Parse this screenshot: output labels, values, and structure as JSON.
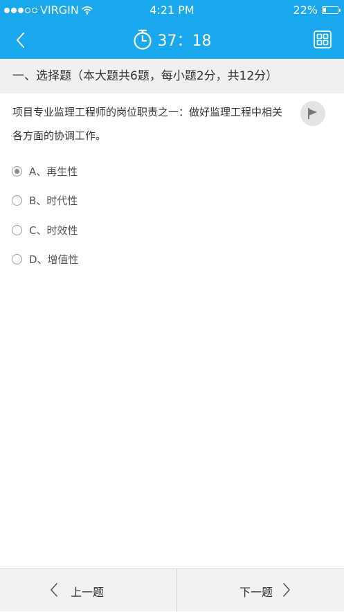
{
  "status_bar": {
    "carrier": "VIRGIN",
    "time": "4:21 PM",
    "battery_text": "22%",
    "battery_level": 0.22,
    "signal_bars_filled": 3,
    "signal_bars_total": 5
  },
  "nav": {
    "back_icon": "chevron-left-icon",
    "timer_icon": "stopwatch-icon",
    "timer_text": "37：18",
    "grid_icon": "grid-icon"
  },
  "section": {
    "title": "一、选择题（本大题共6题，每小题2分，共12分）"
  },
  "question": {
    "text": "项目专业监理工程师的岗位职责之一：做好监理工程中相关各方面的协调工作。",
    "flag_icon": "flag-icon"
  },
  "options": [
    {
      "label": "A、再生性",
      "selected": true
    },
    {
      "label": "B、时代性",
      "selected": false
    },
    {
      "label": "C、时效性",
      "selected": false
    },
    {
      "label": "D、增值性",
      "selected": false
    }
  ],
  "footer": {
    "prev_label": "上一题",
    "next_label": "下一题"
  },
  "colors": {
    "header": "#19a7ee",
    "section_bg": "#f0f0f0",
    "footer_bg": "#f2f2f2"
  }
}
